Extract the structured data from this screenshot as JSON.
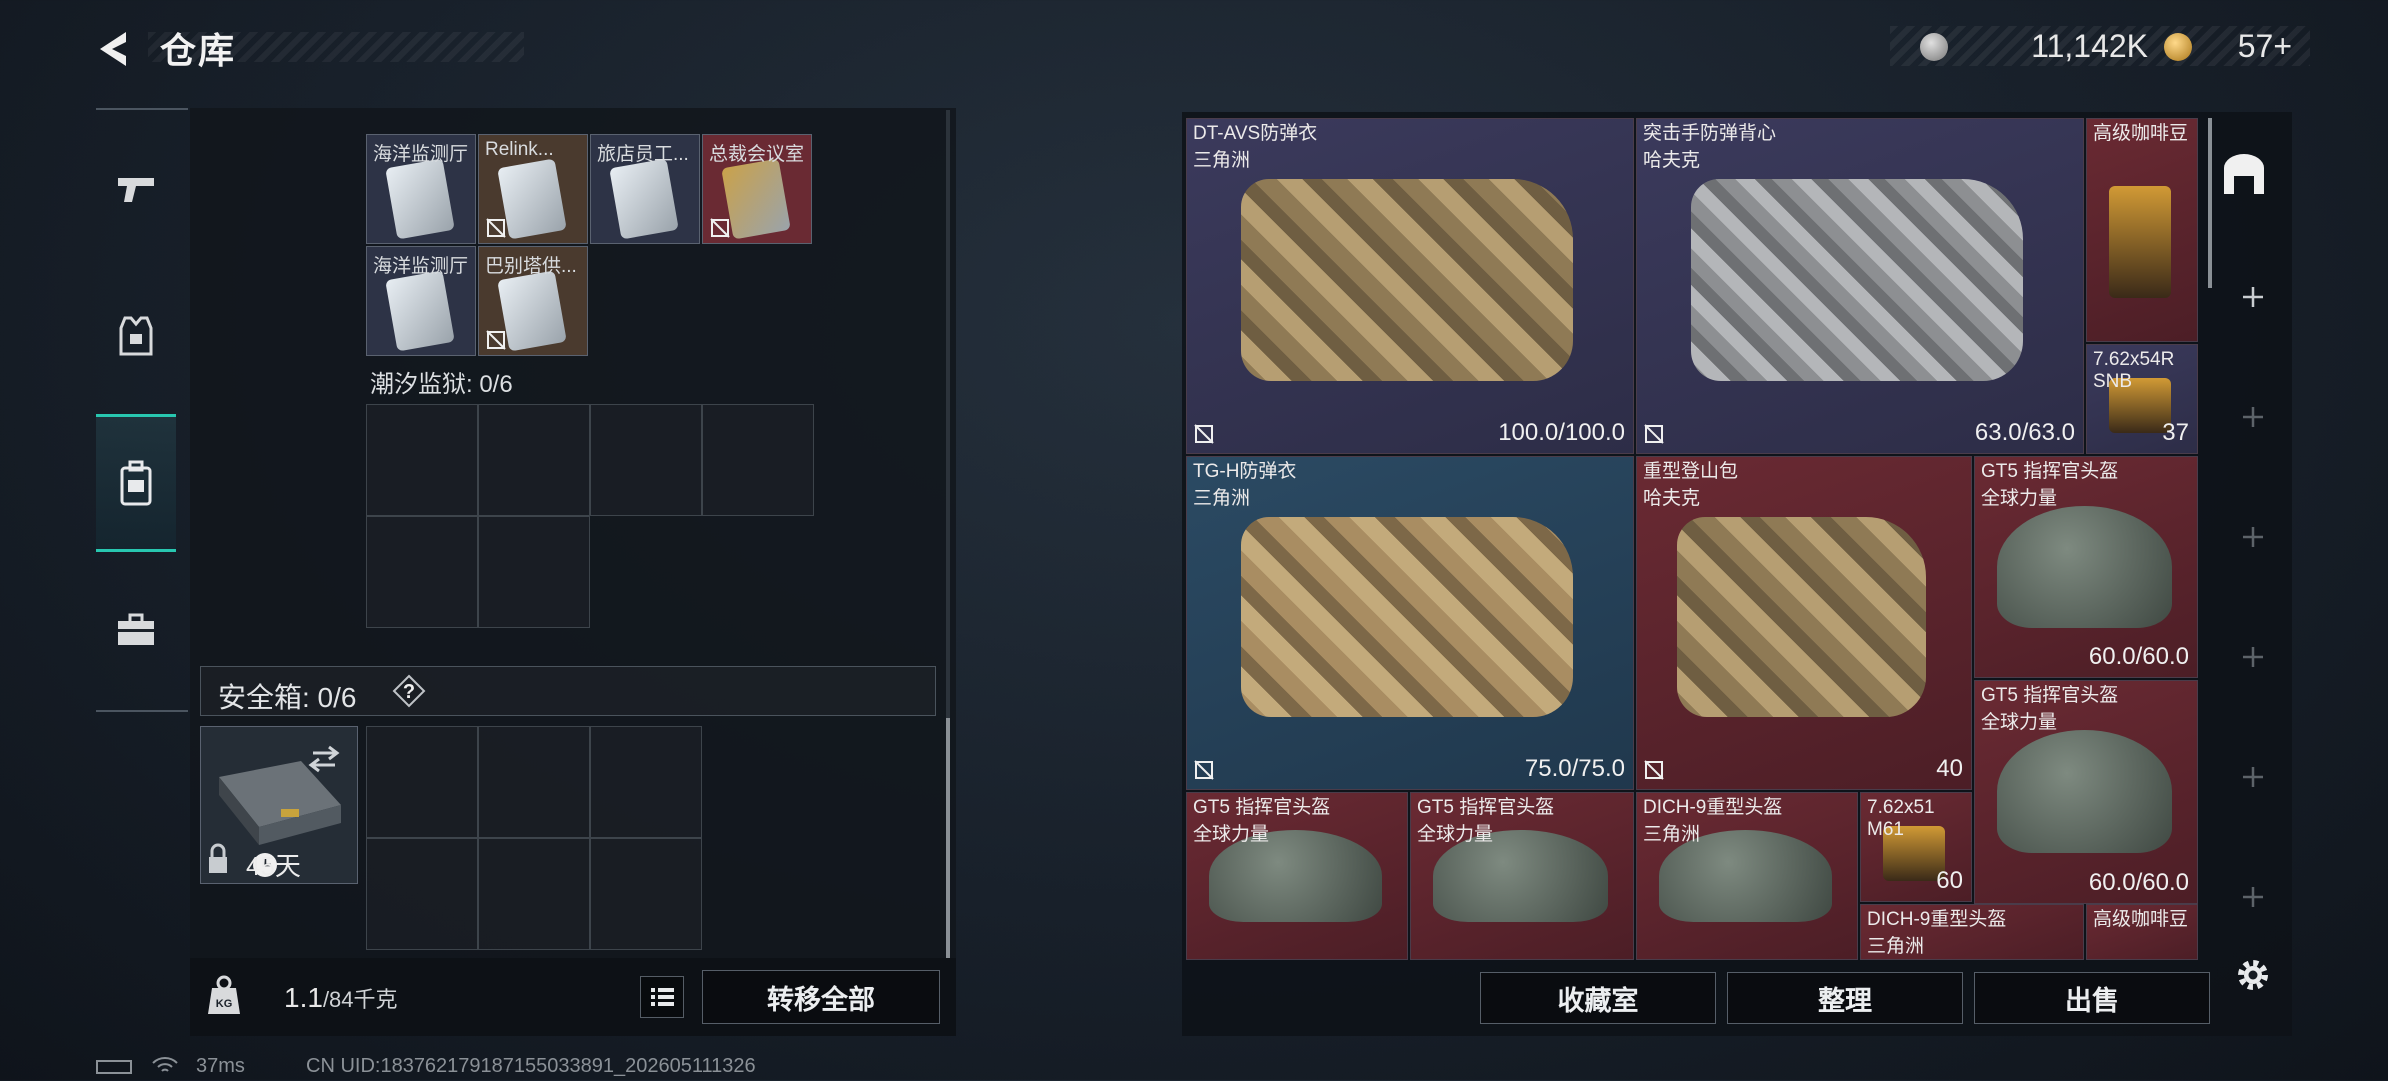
{
  "header": {
    "title": "仓库",
    "coins": "11,142K",
    "tokens": "57+"
  },
  "sidebar": {
    "items": [
      {
        "name": "weapons",
        "icon": "pistol-icon"
      },
      {
        "name": "equipment",
        "icon": "vest-icon"
      },
      {
        "name": "backpack",
        "icon": "backpack-icon",
        "active": true
      },
      {
        "name": "case",
        "icon": "briefcase-icon"
      }
    ]
  },
  "left_panel": {
    "keycards": [
      {
        "label": "海洋监测厅",
        "color": "#e8eef3",
        "bg": "#2d3346",
        "no_trade": false
      },
      {
        "label": "Relink...",
        "color": "#e8eef3",
        "bg": "#4a3a2e",
        "no_trade": true
      },
      {
        "label": "旅店员工...",
        "color": "#e8eef3",
        "bg": "#2d3346",
        "no_trade": false
      },
      {
        "label": "总裁会议室",
        "color": "#caa24a",
        "bg": "#6a2a33",
        "no_trade": true
      },
      {
        "label": "海洋监测厅",
        "color": "#e8eef3",
        "bg": "#2d3346",
        "no_trade": false
      },
      {
        "label": "巴别塔供...",
        "color": "#e8eef3",
        "bg": "#4a3a2e",
        "no_trade": true
      }
    ],
    "tide_prison_label": "潮汐监狱: 0/6",
    "safe_box": {
      "title": "安全箱:  0/6",
      "help": "?",
      "timer": "45天"
    },
    "weight": {
      "current": "1.1",
      "max": "/84千克"
    },
    "transfer_all": "转移全部"
  },
  "stash": {
    "items": [
      {
        "name": "DT-AVS防弹衣",
        "sub": "三角洲",
        "value": "100.0/100.0",
        "bg": "purple"
      },
      {
        "name": "突击手防弹背心",
        "sub": "哈夫克",
        "value": "63.0/63.0",
        "bg": "purple"
      },
      {
        "name": "高级咖啡豆",
        "sub": "",
        "value": "",
        "bg": "red"
      },
      {
        "name": "7.62x54R",
        "sub": "SNB",
        "value": "37",
        "bg": "purple"
      },
      {
        "name": "TG-H防弹衣",
        "sub": "三角洲",
        "value": "75.0/75.0",
        "bg": "blue"
      },
      {
        "name": "重型登山包",
        "sub": "哈夫克",
        "value": "40",
        "bg": "red"
      },
      {
        "name": "GT5 指挥官头盔",
        "sub": "全球力量",
        "value": "60.0/60.0",
        "bg": "red"
      },
      {
        "name": "GT5 指挥官头盔",
        "sub": "全球力量",
        "value": "60.0/60.0",
        "bg": "red"
      },
      {
        "name": "GT5 指挥官头盔",
        "sub": "全球力量",
        "value": "",
        "bg": "red"
      },
      {
        "name": "GT5 指挥官头盔",
        "sub": "全球力量",
        "value": "",
        "bg": "red"
      },
      {
        "name": "DICH-9重型头盔",
        "sub": "三角洲",
        "value": "",
        "bg": "red"
      },
      {
        "name": "7.62x51",
        "sub": "M61",
        "value": "60",
        "bg": "red"
      },
      {
        "name": "DICH-9重型头盔",
        "sub": "三角洲",
        "value": "",
        "bg": "red"
      },
      {
        "name": "高级咖啡豆",
        "sub": "",
        "value": "",
        "bg": "red"
      }
    ],
    "actions": {
      "collection": "收藏室",
      "sort": "整理",
      "sell": "出售"
    }
  },
  "status": {
    "ping": "37ms",
    "uid": "CN UID:183762179187155033891_202605111326"
  },
  "colors": {
    "accent": "#28c7b0",
    "rarity_purple": "#3b3a5c",
    "rarity_red": "#6a2a33",
    "rarity_blue": "#2b4a63"
  }
}
